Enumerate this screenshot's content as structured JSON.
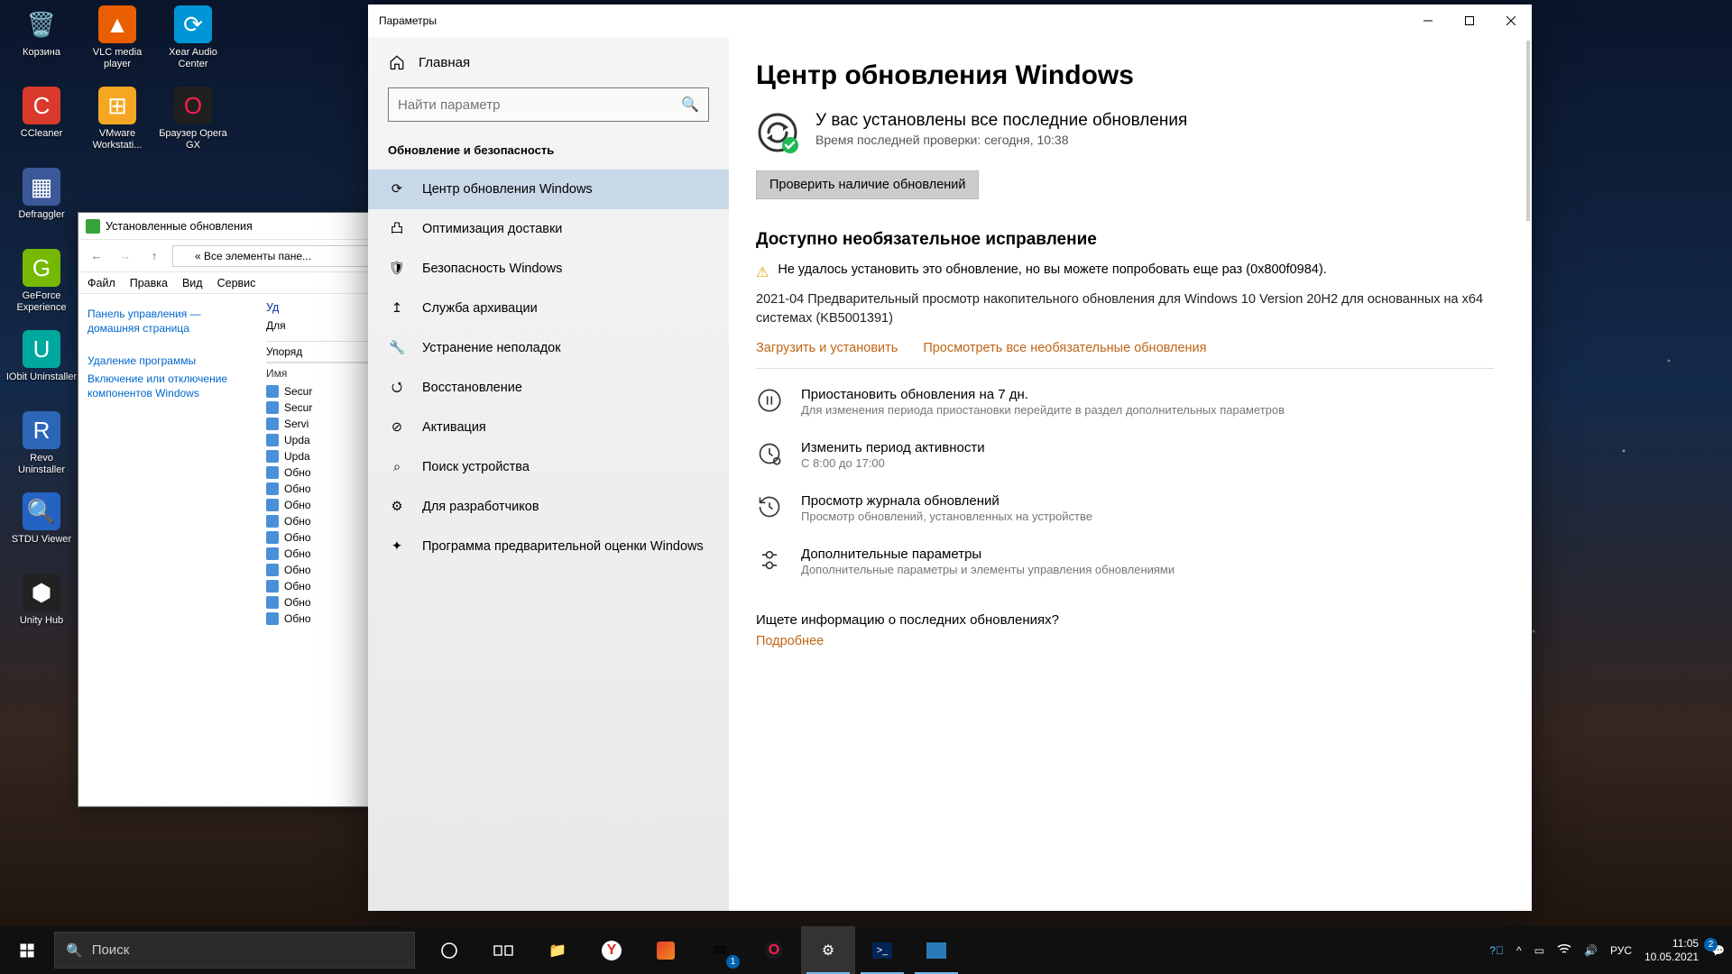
{
  "desktop_icons": [
    {
      "label": "Корзина"
    },
    {
      "label": "VLC media player"
    },
    {
      "label": "Xear Audio Center"
    },
    {
      "label": "CCleaner"
    },
    {
      "label": "VMware Workstati..."
    },
    {
      "label": "Браузер Opera GX"
    },
    {
      "label": "Defraggler"
    },
    {
      "label": ""
    },
    {
      "label": ""
    },
    {
      "label": "GeForce Experience"
    },
    {
      "label": ""
    },
    {
      "label": ""
    },
    {
      "label": "IObit Uninstaller"
    },
    {
      "label": ""
    },
    {
      "label": ""
    },
    {
      "label": "Revo Uninstaller"
    },
    {
      "label": ""
    },
    {
      "label": ""
    },
    {
      "label": "STDU Viewer"
    },
    {
      "label": ""
    },
    {
      "label": ""
    },
    {
      "label": "Unity Hub"
    }
  ],
  "cp": {
    "title": "Установленные обновления",
    "address": "« Все элементы пане...",
    "menu": [
      "Файл",
      "Правка",
      "Вид",
      "Сервис"
    ],
    "side": {
      "home": "Панель управления — домашняя страница",
      "uninstall": "Удаление программы",
      "features": "Включение или отключение компонентов Windows"
    },
    "main": {
      "action1": "Уд",
      "action2": "Для",
      "sort": "Упоряд",
      "col_name": "Имя",
      "rows": [
        "Secur",
        "Secur",
        "Servi",
        "Upda",
        "Upda",
        "Обно",
        "Обно",
        "Обно",
        "Обно",
        "Обно",
        "Обно",
        "Обно",
        "Обно",
        "Обно",
        "Обно"
      ]
    }
  },
  "settings": {
    "window_title": "Параметры",
    "home": "Главная",
    "search_placeholder": "Найти параметр",
    "category": "Обновление и безопасность",
    "nav": [
      "Центр обновления Windows",
      "Оптимизация доставки",
      "Безопасность Windows",
      "Служба архивации",
      "Устранение неполадок",
      "Восстановление",
      "Активация",
      "Поиск устройства",
      "Для разработчиков",
      "Программа предварительной оценки Windows"
    ],
    "main": {
      "title": "Центр обновления Windows",
      "status_line1": "У вас установлены все последние обновления",
      "status_line2": "Время последней проверки: сегодня, 10:38",
      "check_btn": "Проверить наличие обновлений",
      "optional_title": "Доступно необязательное исправление",
      "optional_warn": "Не удалось установить это обновление, но вы можете попробовать еще раз (0x800f0984).",
      "optional_desc": "2021-04 Предварительный просмотр накопительного обновления для Windows 10 Version 20H2 для основанных на x64 системах (KB5001391)",
      "link_install": "Загрузить и установить",
      "link_viewall": "Просмотреть все необязательные обновления",
      "opts": [
        {
          "t1": "Приостановить обновления на 7 дн.",
          "t2": "Для изменения периода приостановки перейдите в раздел дополнительных параметров"
        },
        {
          "t1": "Изменить период активности",
          "t2": "С 8:00 до 17:00"
        },
        {
          "t1": "Просмотр журнала обновлений",
          "t2": "Просмотр обновлений, установленных на устройстве"
        },
        {
          "t1": "Дополнительные параметры",
          "t2": "Дополнительные параметры и элементы управления обновлениями"
        }
      ],
      "footer_q": "Ищете информацию о последних обновлениях?",
      "footer_link": "Подробнее"
    }
  },
  "taskbar": {
    "search_placeholder": "Поиск",
    "lang": "РУС",
    "time": "11:05",
    "date": "10.05.2021",
    "mail_badge": "1",
    "action_badge": "2"
  }
}
